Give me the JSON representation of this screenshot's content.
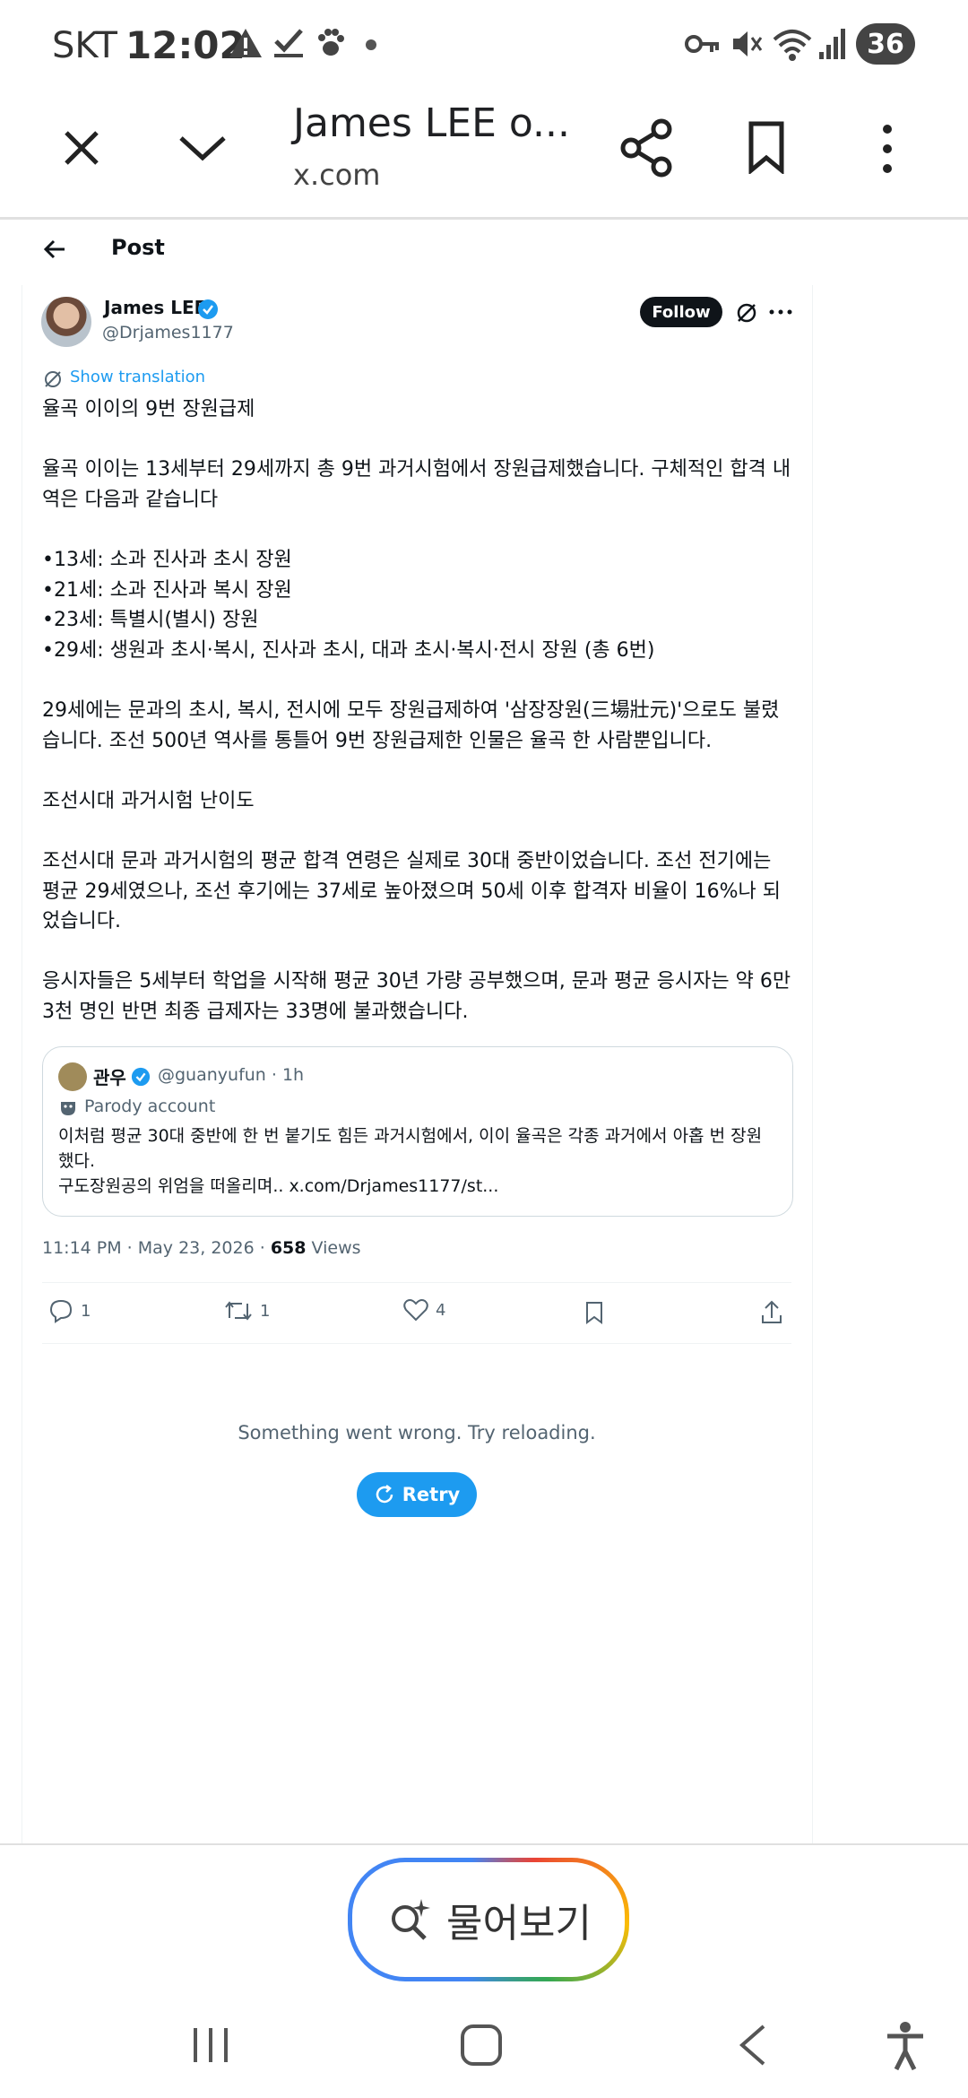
{
  "status_bar": {
    "carrier": "SKT",
    "time": "12:02",
    "battery": "36",
    "icons": [
      "alert-icon",
      "check-icon",
      "paw-icon",
      "dot-icon",
      "key-icon",
      "mute-icon",
      "wifi-icon",
      "signal-icon"
    ]
  },
  "browser": {
    "title": "James LEE o...",
    "url": "x.com"
  },
  "post_header": {
    "title": "Post"
  },
  "author": {
    "name": "James LEE",
    "handle": "@Drjames1177",
    "follow_label": "Follow"
  },
  "translate_label": "Show translation",
  "post_text": "율곡 이이의 9번 장원급제\n\n율곡 이이는 13세부터 29세까지 총 9번 과거시험에서 장원급제했습니다. 구체적인 합격 내역은 다음과 같습니다\n\n•13세: 소과 진사과 초시 장원\n•21세: 소과 진사과 복시 장원\n•23세: 특별시(별시) 장원\n•29세: 생원과 초시·복시, 진사과 초시, 대과 초시·복시·전시 장원 (총 6번)\n\n29세에는 문과의 초시, 복시, 전시에 모두 장원급제하여 '삼장장원(三場壯元)'으로도 불렸습니다. 조선 500년 역사를 통틀어 9번 장원급제한 인물은 율곡 한 사람뿐입니다.\n\n조선시대 과거시험 난이도\n\n조선시대 문과 과거시험의 평균 합격 연령은 실제로 30대 중반이었습니다. 조선 전기에는 평균 29세였으나, 조선 후기에는 37세로 높아졌으며 50세 이후 합격자 비율이 16%나 되었습니다.\n\n응시자들은 5세부터 학업을 시작해 평균 30년 가량 공부했으며, 문과 평균 응시자는 약 6만 3천 명인 반면 최종 급제자는 33명에 불과했습니다.",
  "quote": {
    "name": "관우",
    "handle": "@guanyufun · 1h",
    "label": "Parody account",
    "text": "이처럼 평균 30대 중반에 한 번 붙기도 힘든 과거시험에서, 이이 율곡은 각종 과거에서 아홉 번 장원했다.\n구도장원공의 위엄을 떠올리며.. x.com/Drjames1177/st..."
  },
  "meta": {
    "timestamp": "11:14 PM · May 23, 2026 · ",
    "views_count": "658",
    "views_label": " Views"
  },
  "actions": {
    "replies": "1",
    "reposts": "1",
    "likes": "4"
  },
  "error": {
    "message": "Something went wrong. Try reloading.",
    "retry_label": "Retry"
  },
  "ask_button": {
    "label": "물어보기"
  },
  "colors": {
    "accent": "#1d9bf0",
    "text": "#0f1419",
    "secondary": "#536471"
  }
}
